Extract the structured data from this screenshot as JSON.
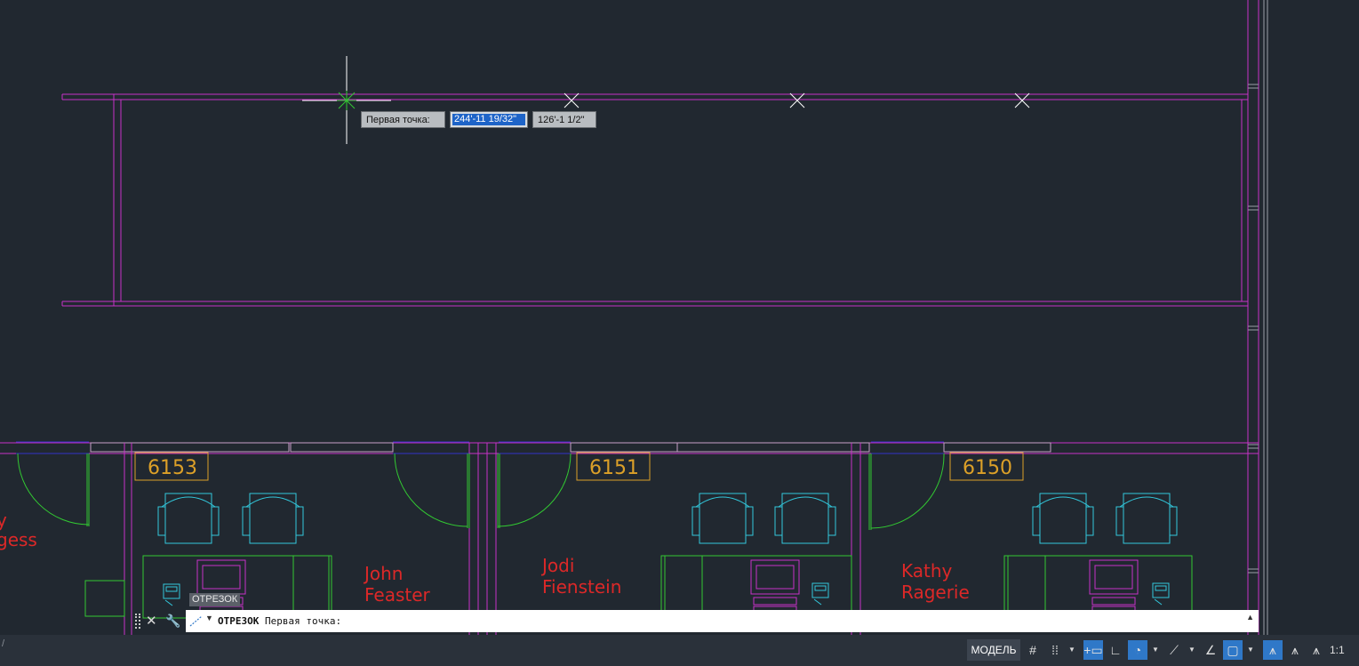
{
  "colors": {
    "background": "#212830",
    "wall": "#c832c8",
    "furniture": "#32c8dc",
    "door": "#32c832",
    "room_number": "#dca028",
    "occupant_name": "#dc2828",
    "window": "#3232c8",
    "crosshair": "#ffffff",
    "snap_marker": "#32c832",
    "statusbar_active": "#2f78c8"
  },
  "dynamic_input": {
    "prompt": "Первая точка:",
    "x_value": "244'-11 19/32\"",
    "y_value": "126'-1 1/2\""
  },
  "tooltip": {
    "text": "ОТРЕЗОК"
  },
  "rooms": [
    {
      "number": "6153",
      "occupant_line1": "John",
      "occupant_line2": "Feaster"
    },
    {
      "number": "6151",
      "occupant_line1": "Jodi",
      "occupant_line2": "Fienstein"
    },
    {
      "number": "6150",
      "occupant_line1": "Kathy",
      "occupant_line2": "Ragerie"
    }
  ],
  "partial_room": {
    "occupant_line1": "y",
    "occupant_line2": "gess"
  },
  "command_line": {
    "command": "ОТРЕЗОК",
    "prompt": "Первая точка:"
  },
  "status_bar": {
    "left_text": "/",
    "model_tab": "МОДЕЛЬ",
    "scale": "1:1",
    "buttons": [
      {
        "icon": "grid-icon",
        "active": false
      },
      {
        "icon": "snap-mode-icon",
        "active": false
      },
      {
        "icon": "dynamic-input-icon",
        "active": true
      },
      {
        "icon": "ortho-icon",
        "active": false
      },
      {
        "icon": "polar-tracking-icon",
        "active": true
      },
      {
        "icon": "object-snap-tracking-icon",
        "active": false
      },
      {
        "icon": "isometric-icon",
        "active": false
      },
      {
        "icon": "object-snap-icon",
        "active": true
      },
      {
        "icon": "annotation-visibility-icon",
        "active": true
      },
      {
        "icon": "autoscale-icon",
        "active": false
      },
      {
        "icon": "annotation-scale-icon",
        "active": false
      }
    ]
  }
}
